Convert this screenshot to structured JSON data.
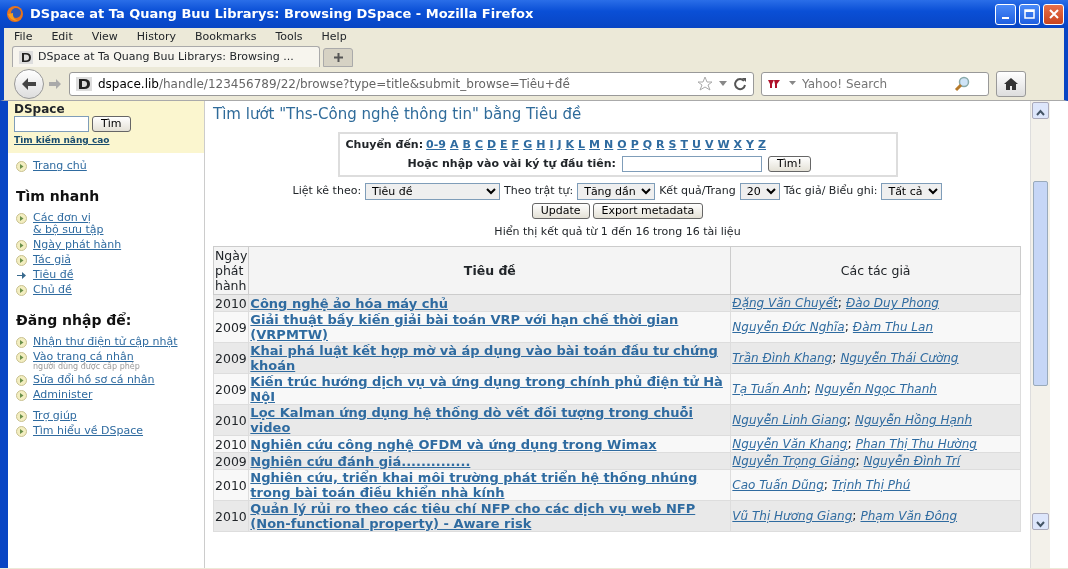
{
  "window": {
    "title": "DSpace at Ta Quang Buu Librarys: Browsing DSpace - Mozilla Firefox"
  },
  "menu": [
    "File",
    "Edit",
    "View",
    "History",
    "Bookmarks",
    "Tools",
    "Help"
  ],
  "tabs": [
    {
      "label": "DSpace at Ta Quang Buu Librarys: Browsing ...",
      "selected": true
    }
  ],
  "address_bar": {
    "host": "dspace.lib",
    "path": "/handle/123456789/22/browse?type=title&submit_browse=Tiêu+đề"
  },
  "search": {
    "placeholder": "Yahoo! Search"
  },
  "sidebar": {
    "brand": "DSpace",
    "search_button": "Tìm",
    "advanced_link": "Tìm kiếm nâng cao",
    "sections": [
      {
        "items": [
          {
            "label": "Trang chủ",
            "selected": false
          }
        ]
      },
      {
        "heading": "Tìm nhanh",
        "items": [
          {
            "label": "Các đơn vị\n& bộ sưu tập",
            "selected": false
          },
          {
            "label": "Ngày phát hành",
            "selected": false
          },
          {
            "label": "Tác giả",
            "selected": false
          },
          {
            "label": "Tiêu đề",
            "selected": true
          },
          {
            "label": "Chủ đề",
            "selected": false
          }
        ]
      },
      {
        "heading": "Đăng nhập để:",
        "items": [
          {
            "label": "Nhận thư điện tử cập nhật",
            "selected": false
          },
          {
            "label": "Vào trang cá nhân",
            "note": "người dùng được cấp phép",
            "selected": false
          },
          {
            "label": "Sửa đổi hồ sơ cá nhân",
            "selected": false
          },
          {
            "label": "Administer",
            "selected": false
          }
        ]
      },
      {
        "items": [
          {
            "label": "Trợ giúp",
            "selected": false
          },
          {
            "label": "Tìm hiểu về DSpace",
            "selected": false
          }
        ]
      }
    ]
  },
  "page": {
    "heading": "Tìm lướt \"Ths-Công nghệ thông tin\" bằng Tiêu đề",
    "jump_label": "Chuyển đến:",
    "letters": [
      "0-9",
      "A",
      "B",
      "C",
      "D",
      "E",
      "F",
      "G",
      "H",
      "I",
      "J",
      "K",
      "L",
      "M",
      "N",
      "O",
      "P",
      "Q",
      "R",
      "S",
      "T",
      "U",
      "V",
      "W",
      "X",
      "Y",
      "Z"
    ],
    "input_label": "Hoặc nhập vào vài ký tự đầu tiên:",
    "go_button": "Tìm!",
    "options": [
      {
        "label": "Liệt kê theo:",
        "value": "Tiêu đề"
      },
      {
        "label": "Theo trật tự:",
        "value": "Tăng dần"
      },
      {
        "label": "Kết quả/Trang",
        "value": "20"
      },
      {
        "label": "Tác giả/ Biểu ghi:",
        "value": "Tất cả"
      }
    ],
    "buttons": [
      "Update",
      "Export metadata"
    ],
    "result_text": "Hiển thị kết quả từ 1 đến 16 trong 16 tài liệu"
  },
  "table": {
    "author_separator": ";",
    "columns": [
      "Ngày phát hành",
      "Tiêu đề",
      "Các tác giả"
    ],
    "rows": [
      {
        "date": "2010",
        "title": "Công nghệ ảo hóa máy chủ",
        "authors": [
          "Đặng Văn Chuyết",
          "Đào Duy Phong"
        ]
      },
      {
        "date": "2009",
        "title": "Giải thuật bầy kiến giải bài toán VRP với hạn chế thời gian (VRPMTW)",
        "authors": [
          "Nguyễn Đức Nghĩa",
          "Đàm Thu Lan"
        ]
      },
      {
        "date": "2009",
        "title": "Khai phá luật kết hợp mờ và áp dụng vào bài toán đầu tư chứng khoán",
        "authors": [
          "Trần Đình Khang",
          "Nguyễn Thái Cường"
        ]
      },
      {
        "date": "2009",
        "title": "Kiến trúc hướng dịch vụ và ứng dụng trong chính phủ điện tử Hà NộI",
        "authors": [
          "Tạ Tuấn Anh",
          "Nguyễn Ngọc Thanh"
        ]
      },
      {
        "date": "2010",
        "title": "Lọc Kalman ứng dụng hệ thống dò vết đối tượng trong chuỗi video",
        "authors": [
          "Nguyễn Linh Giang",
          "Nguyễn Hồng Hạnh"
        ]
      },
      {
        "date": "2010",
        "title": "Nghiên cứu công nghệ OFDM và ứng dụng trong Wimax",
        "authors": [
          "Nguyễn Văn Khang",
          "Phan Thị Thu Hường"
        ]
      },
      {
        "date": "2009",
        "title": "Nghiên cứu đánh giá..............",
        "authors": [
          "Nguyễn Trọng Giảng",
          "Nguyễn Đình Trí"
        ]
      },
      {
        "date": "2010",
        "title": "Nghiên cứu, triển khai môi trường phát triển hệ thống nhúng trong bài toán điều khiển nhà kính",
        "authors": [
          "Cao Tuấn Dũng",
          "Trịnh Thị Phú"
        ]
      },
      {
        "date": "2010",
        "title": "Quản lý rủi ro theo các tiêu chí NFP cho các dịch vụ web NFP (Non-functional property) - Aware risk",
        "authors": [
          "Vũ Thị Hương Giang",
          "Phạm Văn Đông"
        ]
      }
    ]
  }
}
